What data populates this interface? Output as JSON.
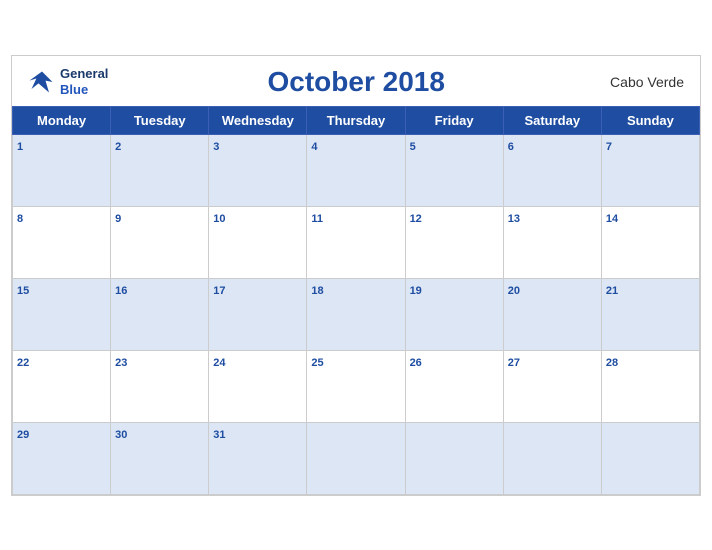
{
  "header": {
    "logo": {
      "general": "General",
      "blue": "Blue"
    },
    "title": "October 2018",
    "country": "Cabo Verde"
  },
  "weekdays": [
    "Monday",
    "Tuesday",
    "Wednesday",
    "Thursday",
    "Friday",
    "Saturday",
    "Sunday"
  ],
  "weeks": [
    [
      {
        "day": 1
      },
      {
        "day": 2
      },
      {
        "day": 3
      },
      {
        "day": 4
      },
      {
        "day": 5
      },
      {
        "day": 6
      },
      {
        "day": 7
      }
    ],
    [
      {
        "day": 8
      },
      {
        "day": 9
      },
      {
        "day": 10
      },
      {
        "day": 11
      },
      {
        "day": 12
      },
      {
        "day": 13
      },
      {
        "day": 14
      }
    ],
    [
      {
        "day": 15
      },
      {
        "day": 16
      },
      {
        "day": 17
      },
      {
        "day": 18
      },
      {
        "day": 19
      },
      {
        "day": 20
      },
      {
        "day": 21
      }
    ],
    [
      {
        "day": 22
      },
      {
        "day": 23
      },
      {
        "day": 24
      },
      {
        "day": 25
      },
      {
        "day": 26
      },
      {
        "day": 27
      },
      {
        "day": 28
      }
    ],
    [
      {
        "day": 29
      },
      {
        "day": 30
      },
      {
        "day": 31
      },
      {
        "day": null
      },
      {
        "day": null
      },
      {
        "day": null
      },
      {
        "day": null
      }
    ]
  ],
  "colors": {
    "header_bg": "#1e4da1",
    "odd_row_bg": "#dce6f5",
    "even_row_bg": "#ffffff",
    "day_number": "#1e4da1"
  }
}
